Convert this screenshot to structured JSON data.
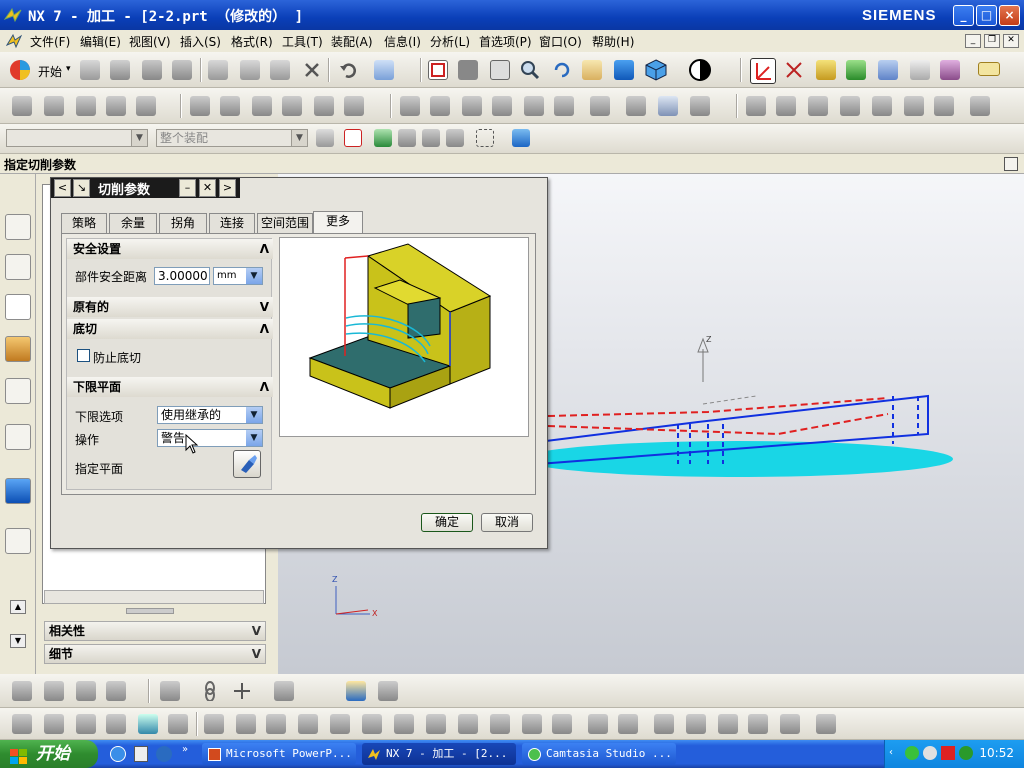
{
  "titlebar": {
    "title": "NX 7 - 加工 - [2-2.prt （修改的） ]",
    "brand": "SIEMENS",
    "minimize": "_",
    "maximize": "□",
    "close": "×"
  },
  "menubar": {
    "items": [
      "文件(F)",
      "编辑(E)",
      "视图(V)",
      "插入(S)",
      "格式(R)",
      "工具(T)",
      "装配(A)",
      "信息(I)",
      "分析(L)",
      "首选项(P)",
      "窗口(O)",
      "帮助(H)"
    ]
  },
  "toolbar": {
    "start_label": "开始",
    "start_chevron": "▾",
    "filter_combo": "",
    "assembly_combo": "整个装配"
  },
  "cue_line": {
    "text": "指定切削参数"
  },
  "navigator": {
    "sections": [
      {
        "label": "相关性"
      },
      {
        "label": "细节"
      }
    ]
  },
  "dialog": {
    "title": "切削参数",
    "tabs": [
      "策略",
      "余量",
      "拐角",
      "连接",
      "空间范围",
      "更多"
    ],
    "active_tab": "更多",
    "sections": {
      "safety": {
        "label": "安全设置",
        "part_clearance_label": "部件安全距离",
        "part_clearance_value": "3.00000",
        "unit": "mm"
      },
      "legacy": {
        "label": "原有的"
      },
      "undercut": {
        "label": "底切",
        "prevent_label": "防止底切",
        "prevent_checked": false
      },
      "floor": {
        "label": "下限平面",
        "option_label": "下限选项",
        "option_value": "使用继承的",
        "action_label": "操作",
        "action_value": "警告",
        "plane_label": "指定平面"
      }
    },
    "ok_label": "确定",
    "cancel_label": "取消"
  },
  "taskbar": {
    "start_label": "开始",
    "tasks": [
      {
        "label": "Microsoft PowerP..."
      },
      {
        "label": "NX 7 - 加工 - [2..."
      },
      {
        "label": "Camtasia Studio ..."
      }
    ],
    "clock": "10:52"
  },
  "colors": {
    "titlebar": "#0a3fb8",
    "dialog_header": "#1b1b1b",
    "part_body": "#c9c21a",
    "part_floor": "#2f6d6d",
    "toolpath_red": "#e02020",
    "toolpath_cyan": "#19d6e6",
    "toolpath_blue": "#1030e0"
  }
}
